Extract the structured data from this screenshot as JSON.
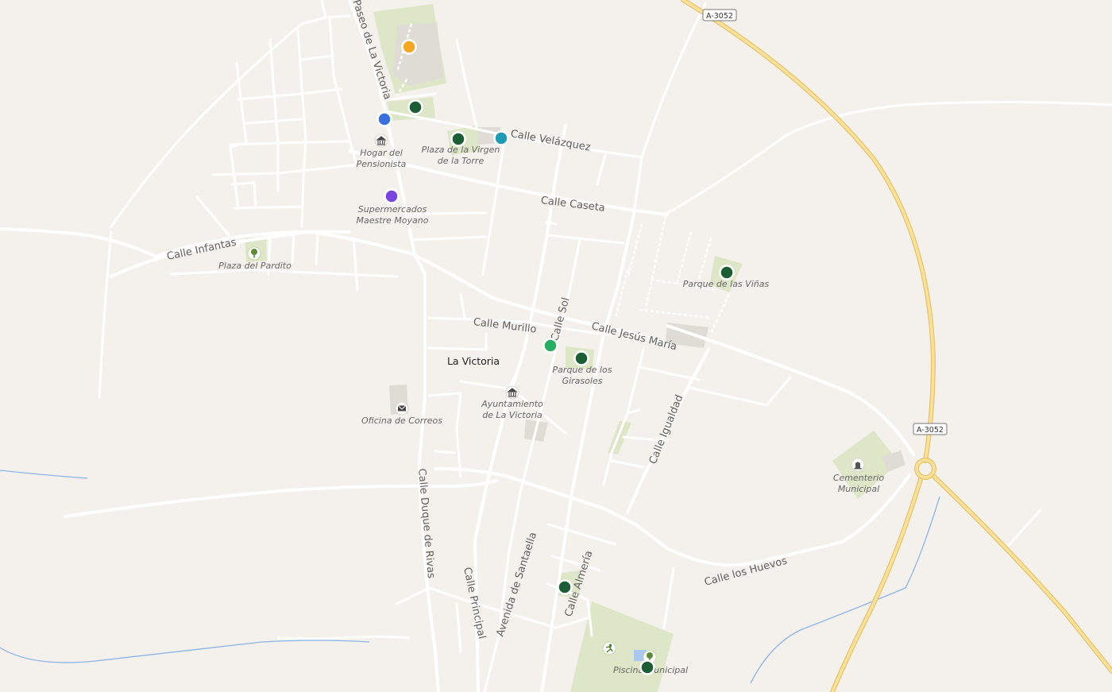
{
  "map": {
    "place_name": "La Victoria",
    "road_shields": {
      "a3052_top": "A-3052",
      "a3052_right": "A-3052"
    },
    "streets": {
      "paseo_de_la_victoria": "Paseo de La Victoria",
      "velazquez": "Calle Velázquez",
      "caseta": "Calle Caseta",
      "infantas": "Calle Infantas",
      "murillo": "Calle Murillo",
      "jesus_maria": "Calle Jesús María",
      "sol": "Calle Sol",
      "igualdad": "Calle Igualdad",
      "duque_de_rivas": "Calle Duque de Rivas",
      "principal": "Calle Principal",
      "avenida_de_santaella": "Avenida de Santaella",
      "almeria": "Calle Almería",
      "los_huevos": "Calle los Huevos"
    },
    "pois": {
      "hogar": [
        "Hogar del",
        "Pensionista"
      ],
      "virgen": [
        "Plaza de la Virgen",
        "de la Torre"
      ],
      "supermercados": [
        "Supermercados",
        "Maestre Moyano"
      ],
      "pardito": [
        "Plaza del Pardito"
      ],
      "vinas": [
        "Parque de las Viñas"
      ],
      "girasoles": [
        "Parque de los",
        "Girasoles"
      ],
      "ayuntamiento": [
        "Ayuntamiento",
        "de La Victoria"
      ],
      "correos": [
        "Oficina de Correos"
      ],
      "cementerio": [
        "Cementerio",
        "Municipal"
      ],
      "piscina": [
        "Piscina Municipal"
      ]
    },
    "icons": {
      "museum": "museum-icon",
      "tree": "tree-icon",
      "mail": "mail-icon",
      "cemetery": "cemetery-icon",
      "sports": "sports-icon"
    },
    "colors": {
      "background": "#f4f1ec",
      "road": "#ffffff",
      "highway": "#fbe09a",
      "park": "#dde6c6",
      "water": "#8ab4e8",
      "marker_dark_green": "#1b5e36",
      "marker_green": "#27ae60",
      "marker_orange": "#f5a623",
      "marker_blue": "#3a6fe0",
      "marker_teal": "#1f9bb5",
      "marker_purple": "#7a44e0"
    }
  }
}
